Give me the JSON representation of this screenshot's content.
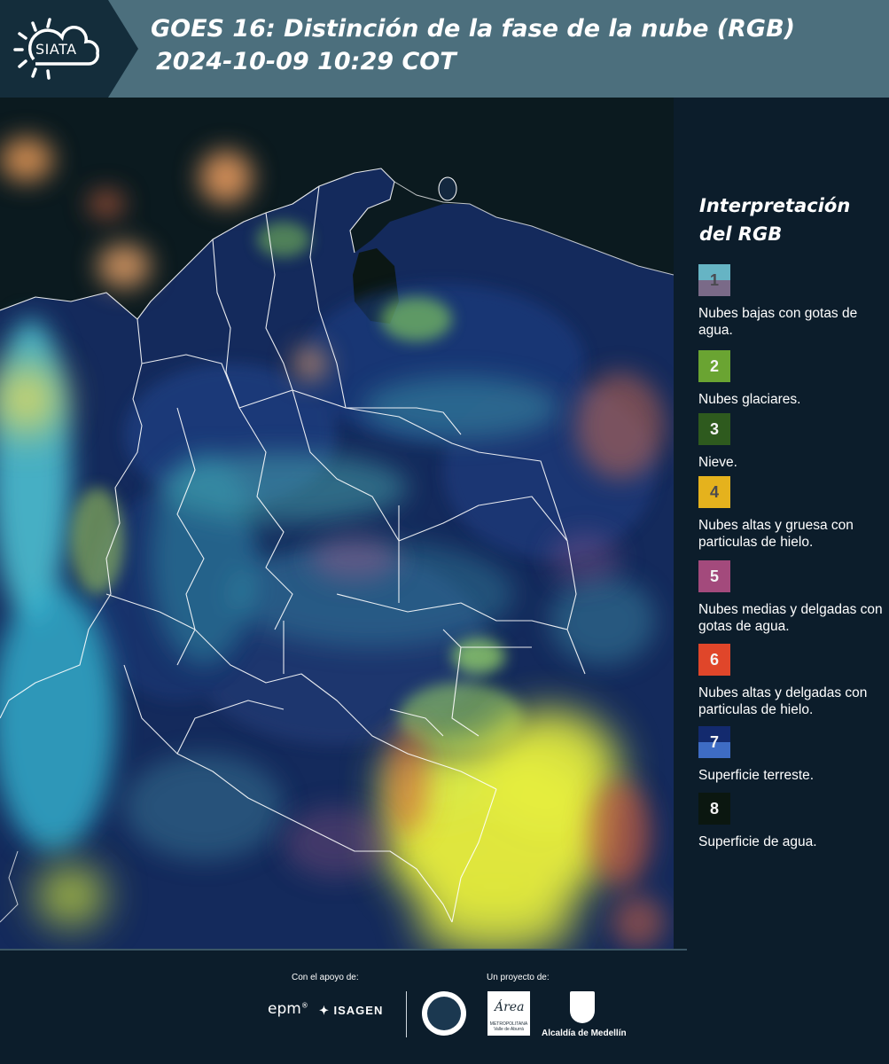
{
  "header": {
    "logo_text": "SIATA",
    "title_line1": "GOES 16: Distinción de la fase de la nube (RGB)",
    "title_line2": "2024-10-09 10:29 COT"
  },
  "map": {
    "icon": "satellite-composite-map"
  },
  "legend": {
    "title": "Interpretación del RGB",
    "items": [
      {
        "number": "1",
        "label": "Nubes bajas con gotas de agua.",
        "colors": [
          "#66b4c4",
          "#7a6a88"
        ]
      },
      {
        "number": "2",
        "label": "Nubes glaciares.",
        "colors": [
          "#6aa432",
          "#6aa432"
        ]
      },
      {
        "number": "3",
        "label": "Nieve.",
        "colors": [
          "#2e5a1e",
          "#2e5a1e"
        ]
      },
      {
        "number": "4",
        "label": "Nubes altas y gruesa con particulas de hielo.",
        "colors": [
          "#e5b21d",
          "#e5b21d"
        ]
      },
      {
        "number": "5",
        "label": "Nubes medias y delgadas con gotas de agua.",
        "colors": [
          "#a34a7c",
          "#a34a7c"
        ]
      },
      {
        "number": "6",
        "label": "Nubes altas y delgadas con particulas de hielo.",
        "colors": [
          "#e0462a",
          "#e0462a"
        ]
      },
      {
        "number": "7",
        "label": "Superficie terreste.",
        "colors": [
          "#132a6e",
          "#3e6cc4"
        ]
      },
      {
        "number": "8",
        "label": "Superficie de agua.",
        "colors": [
          "#0b1710",
          "#0b1710"
        ]
      }
    ]
  },
  "footer": {
    "support_label": "Con el apoyo de:",
    "project_label": "Un proyecto de:",
    "epm": "epm",
    "isagen": "ISAGEN",
    "area_name": "Área",
    "area_sub": "METROPOLITANA Valle de Aburrá",
    "medellin": "Alcaldía de Medellín"
  },
  "colors": {
    "header_bg": "#4c6f7d",
    "panel_bg": "#0c1d2b"
  }
}
